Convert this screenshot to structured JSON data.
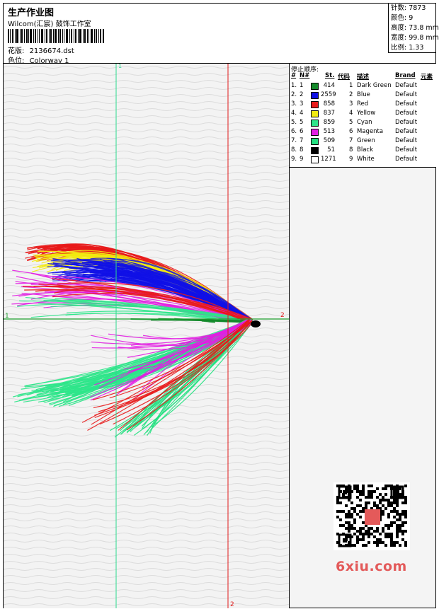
{
  "header": {
    "title": "生产作业图",
    "studio": "Wilcom(汇宸) 鼓饰工作室",
    "design_label": "花版:",
    "design_file": "2136674.dst",
    "colorway_label": "色位:",
    "colorway": "Colorway 1"
  },
  "stats": {
    "stitches": "针数: 7873",
    "colors": "颜色: 9",
    "height": "高度: 73.8 mm",
    "width": "宽度: 99.8 mm",
    "scale": "比例: 1.33"
  },
  "stop_sequence": {
    "title": "停止顺序:",
    "headers": [
      "#",
      "N#",
      "St.",
      "代码",
      "描述",
      "Brand",
      "元素"
    ],
    "rows": [
      {
        "idx": "1.",
        "n": "1",
        "st": "414",
        "code": "1",
        "desc": "Dark Green",
        "brand": "Default",
        "color": "#138a2a"
      },
      {
        "idx": "2.",
        "n": "2",
        "st": "2559",
        "code": "2",
        "desc": "Blue",
        "brand": "Default",
        "color": "#1010e6"
      },
      {
        "idx": "3.",
        "n": "3",
        "st": "858",
        "code": "3",
        "desc": "Red",
        "brand": "Default",
        "color": "#e81a1a"
      },
      {
        "idx": "4.",
        "n": "4",
        "st": "837",
        "code": "4",
        "desc": "Yellow",
        "brand": "Default",
        "color": "#f2ea10"
      },
      {
        "idx": "5.",
        "n": "5",
        "st": "859",
        "code": "5",
        "desc": "Cyan",
        "brand": "Default",
        "color": "#2ee58a"
      },
      {
        "idx": "6.",
        "n": "6",
        "st": "513",
        "code": "6",
        "desc": "Magenta",
        "brand": "Default",
        "color": "#e21ee2"
      },
      {
        "idx": "7.",
        "n": "7",
        "st": "509",
        "code": "7",
        "desc": "Green",
        "brand": "Default",
        "color": "#22e080"
      },
      {
        "idx": "8.",
        "n": "8",
        "st": "51",
        "code": "8",
        "desc": "Black",
        "brand": "Default",
        "color": "#000000"
      },
      {
        "idx": "9.",
        "n": "9",
        "st": "1271",
        "code": "9",
        "desc": "White",
        "brand": "Default",
        "color": "#ffffff"
      }
    ]
  },
  "guides": {
    "v1_label": "1",
    "h1_label": "1",
    "h2_label": "2",
    "v2_label": "2"
  },
  "watermark": {
    "site": "6xiu.com"
  }
}
